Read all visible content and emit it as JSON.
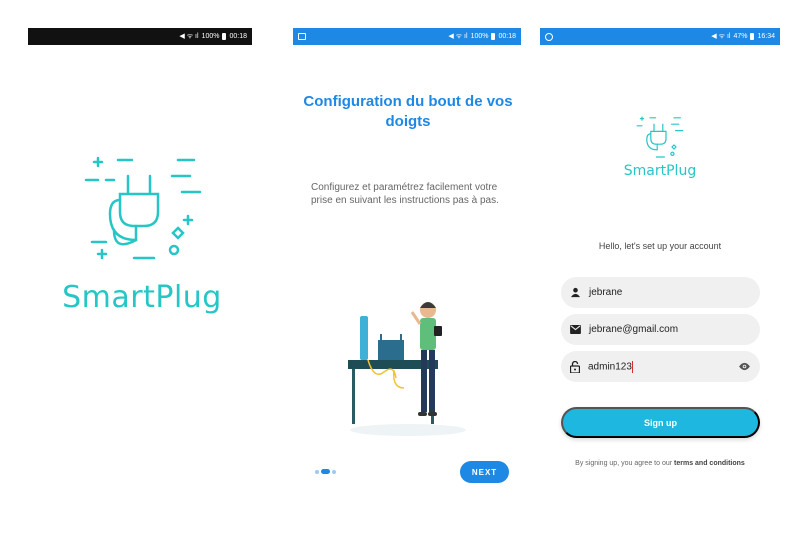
{
  "splash": {
    "status": {
      "signal": "100%",
      "time": "00:18"
    },
    "brand": "SmartPlug"
  },
  "onboarding": {
    "status": {
      "signal": "100%",
      "time": "00:18"
    },
    "title": "Configuration du bout de vos doigts",
    "text": "Configurez et paramétrez facilement votre prise en suivant les instructions pas à pas.",
    "next_label": "NEXT",
    "page_index": 2,
    "page_count": 3
  },
  "signup": {
    "status": {
      "signal": "47%",
      "time": "16:34"
    },
    "brand": "SmartPlug",
    "greeting": "Hello, let's set up your account",
    "username": {
      "value": "jebrane",
      "icon": "person-icon"
    },
    "email": {
      "value": "jebrane@gmail.com",
      "icon": "mail-icon"
    },
    "password": {
      "value": "admin123",
      "icon": "lock-icon",
      "toggle_icon": "eye-icon"
    },
    "signup_label": "Sign up",
    "terms_prefix": "By signing up, you agree to our",
    "terms_link": "terms and conditions"
  },
  "colors": {
    "primary": "#1e88e5",
    "teal": "#26c6c6",
    "button": "#1eb7e0"
  }
}
